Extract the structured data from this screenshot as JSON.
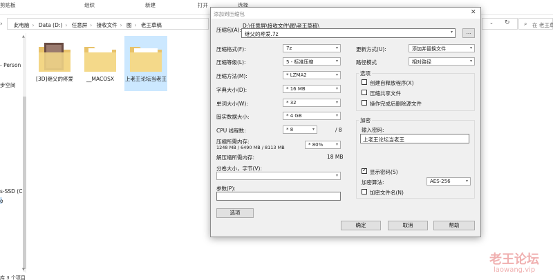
{
  "ribbon": {
    "clipboard": "剪贴板",
    "organize": "组织",
    "new": "新建",
    "open": "打开",
    "select": "选择"
  },
  "address": {
    "crumbs": [
      "此电脑",
      "Data (D:)",
      "任意屏",
      "接收文件",
      "图",
      "老王草稿"
    ],
    "search_placeholder": "在 老王草"
  },
  "sidebar": {
    "items": [
      "- Person",
      "步空间",
      "s-SSD (C",
      "o"
    ]
  },
  "status": "库 3 个项目",
  "folders": [
    {
      "label": "[3D]继父的疼爱",
      "selected": false
    },
    {
      "label": "__MACOSX",
      "selected": false
    },
    {
      "label": "上老王论坛当老王",
      "selected": true
    }
  ],
  "dialog": {
    "title": "添加到压缩包",
    "archive_label": "压缩包(A):",
    "archive_dir": "D:\\任意屏\\接收文件\\图\\老王草稿\\",
    "archive_name": "继父的疼爱.7z",
    "browse_label": "...",
    "format_label": "压缩格式(F):",
    "format_value": "7z",
    "level_label": "压缩等级(L):",
    "level_value": "5 - 标准压缩",
    "method_label": "压缩方法(M):",
    "method_value": "* LZMA2",
    "dict_label": "字典大小(D):",
    "dict_value": "* 16 MB",
    "word_label": "单词大小(W):",
    "word_value": "* 32",
    "solid_label": "固实数据大小:",
    "solid_value": "* 4 GB",
    "threads_label": "CPU 线程数:",
    "threads_value": "* 8",
    "threads_max": "/ 8",
    "mem_label": "压缩所需内存:",
    "mem_values": "1248 MB / 6490 MB / 8113 MB",
    "mem_percent": "* 80%",
    "decomp_label": "解压缩所需内存:",
    "decomp_value": "18 MB",
    "split_label": "分卷大小，字节(V):",
    "params_label": "参数(P):",
    "options_button": "选项",
    "update_label": "更新方式(U):",
    "update_value": "添加并替换文件",
    "pathmode_label": "路径模式",
    "pathmode_value": "相对路径",
    "options_group": "选项",
    "opt_sfx": "创建自释放程序(X)",
    "opt_shared": "压缩共享文件",
    "opt_delete": "操作完成后删除源文件",
    "enc_group": "加密",
    "password_label": "输入密码:",
    "password_value": "上老王论坛当老王",
    "show_password": "显示密码(S)",
    "enc_method_label": "加密算法:",
    "enc_method_value": "AES-256",
    "enc_names": "加密文件名(N)",
    "ok": "确定",
    "cancel": "取消",
    "help": "帮助"
  },
  "watermark": {
    "cn": "老王论坛",
    "en": "laowang.vip"
  }
}
